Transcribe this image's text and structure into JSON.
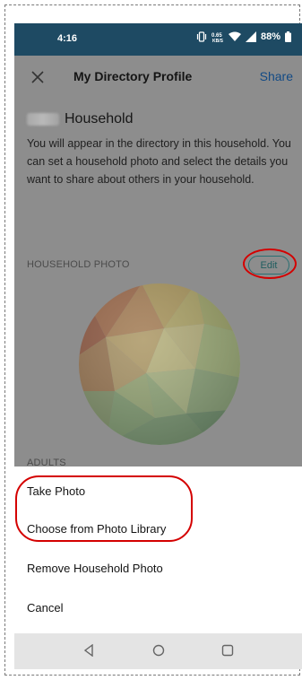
{
  "status_bar": {
    "time": "4:16",
    "battery": "88%"
  },
  "header": {
    "title": "My Directory Profile",
    "share_label": "Share"
  },
  "household": {
    "name": "Household",
    "description": "You will appear in the directory in this household. You can set a household photo and select the details you want to share about others in your household."
  },
  "photo_section": {
    "label": "HOUSEHOLD PHOTO",
    "edit_label": "Edit"
  },
  "adults_label": "ADULTS",
  "action_sheet": {
    "items": [
      "Take Photo",
      "Choose from Photo Library",
      "Remove Household Photo",
      "Cancel"
    ]
  },
  "nav_bar": {
    "buttons": [
      "back-icon",
      "home-icon",
      "recents-icon"
    ]
  },
  "colors": {
    "status_bar": "#1e4a63",
    "accent": "#124a85",
    "highlight_ring": "#d40000"
  }
}
